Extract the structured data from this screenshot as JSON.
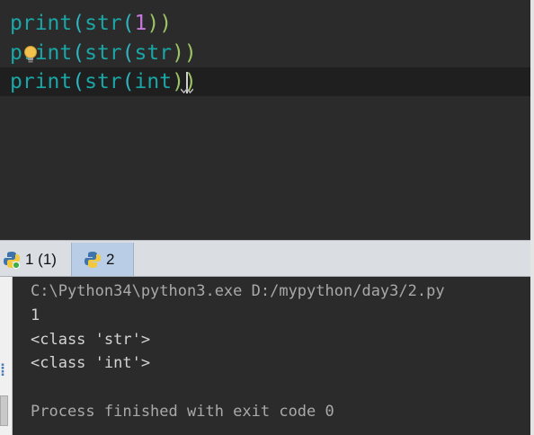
{
  "editor": {
    "lines": [
      {
        "fn": "print",
        "open": "(",
        "inner_fn": "str",
        "inner_open": "(",
        "arg": "1",
        "inner_close": ")",
        "close": ")"
      },
      {
        "fn": "print",
        "open": "(",
        "inner_fn": "str",
        "inner_open": "(",
        "arg": "str",
        "inner_close": ")",
        "close": ")"
      },
      {
        "fn": "print",
        "open": "(",
        "inner_fn": "str",
        "inner_open": "(",
        "arg": "int",
        "inner_close": ")",
        "close": ")"
      }
    ]
  },
  "run_tabs": [
    {
      "label": "1 (1)"
    },
    {
      "label": "2",
      "active": true
    }
  ],
  "console": {
    "lines": [
      "C:\\Python34\\python3.exe D:/mypython/day3/2.py",
      "1",
      "<class 'str'>",
      "<class 'int'>",
      "",
      "Process finished with exit code 0"
    ]
  },
  "colors": {
    "editor_bg": "#2b2b2b",
    "identifier": "#1aa6a6",
    "number": "#c678dd",
    "closing_paren": "#9cc464",
    "console_text": "#d4d4d4",
    "active_tab": "#b9cde6"
  },
  "icons": {
    "bulb": "lightbulb-icon",
    "tab": "python-icon"
  }
}
